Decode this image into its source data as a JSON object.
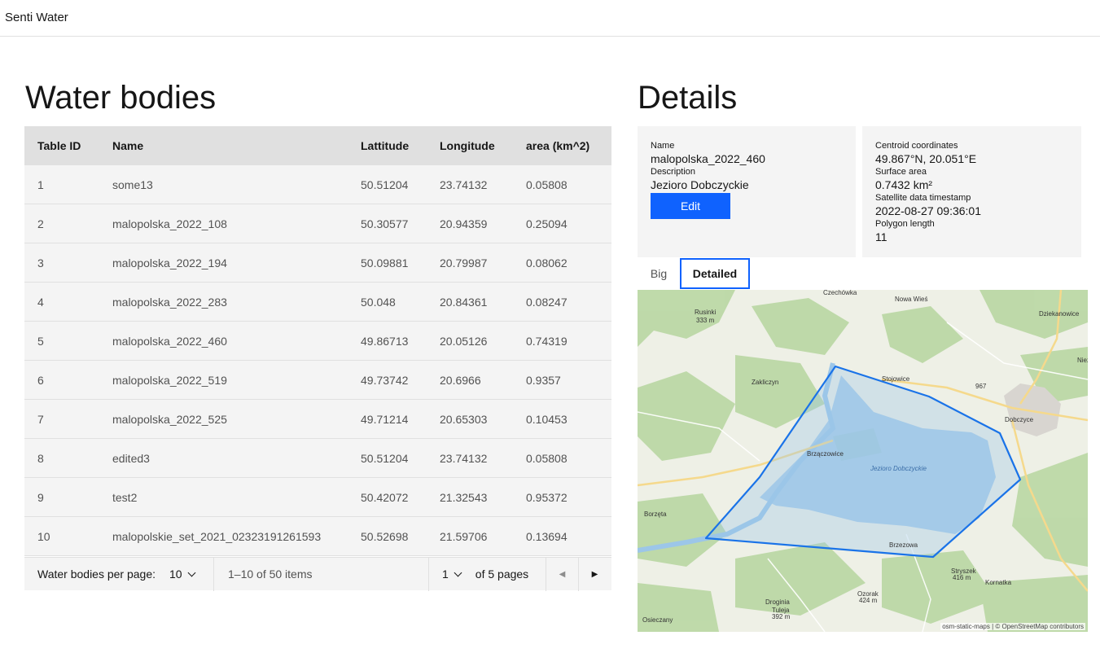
{
  "app": {
    "title": "Senti Water"
  },
  "left": {
    "title": "Water bodies",
    "columns": [
      "Table ID",
      "Name",
      "Lattitude",
      "Longitude",
      "area (km^2)"
    ],
    "rows": [
      [
        "1",
        "some13",
        "50.51204",
        "23.74132",
        "0.05808"
      ],
      [
        "2",
        "malopolska_2022_108",
        "50.30577",
        "20.94359",
        "0.25094"
      ],
      [
        "3",
        "malopolska_2022_194",
        "50.09881",
        "20.79987",
        "0.08062"
      ],
      [
        "4",
        "malopolska_2022_283",
        "50.048",
        "20.84361",
        "0.08247"
      ],
      [
        "5",
        "malopolska_2022_460",
        "49.86713",
        "20.05126",
        "0.74319"
      ],
      [
        "6",
        "malopolska_2022_519",
        "49.73742",
        "20.6966",
        "0.9357"
      ],
      [
        "7",
        "malopolska_2022_525",
        "49.71214",
        "20.65303",
        "0.10453"
      ],
      [
        "8",
        "edited3",
        "50.51204",
        "23.74132",
        "0.05808"
      ],
      [
        "9",
        "test2",
        "50.42072",
        "21.32543",
        "0.95372"
      ],
      [
        "10",
        "malopolskie_set_2021_02323191261593",
        "50.52698",
        "21.59706",
        "0.13694"
      ]
    ],
    "pagination": {
      "per_page_label": "Water bodies per page:",
      "per_page_value": "10",
      "items_range": "1–10 of 50 items",
      "page_value": "1",
      "of_pages": "of 5 pages"
    }
  },
  "details": {
    "title": "Details",
    "name_label": "Name",
    "name_value": "malopolska_2022_460",
    "description_label": "Description",
    "description_value": "Jezioro Dobczyckie",
    "edit_label": "Edit",
    "centroid_label": "Centroid coordinates",
    "centroid_value": "49.867°N, 20.051°E",
    "surface_label": "Surface area",
    "surface_value": "0.7432 km²",
    "timestamp_label": "Satellite data timestamp",
    "timestamp_value": "2022-08-27 09:36:01",
    "polygon_label": "Polygon length",
    "polygon_value": "11",
    "tabs": [
      "Big",
      "Detailed"
    ],
    "active_tab": "Detailed"
  },
  "map": {
    "places": [
      "Czechówka",
      "Nowa Wieś",
      "Dziekanowice",
      "Rusinki 333 m",
      "Zakliczyn",
      "Stojowice",
      "Dobczyce",
      "Brzączowice",
      "Jezioro Dobczyckie",
      "Borzęta",
      "Brzezowa",
      "Droginia",
      "Tuleja 392 m",
      "Osieczany",
      "Kornatka",
      "Stryszek 416 m",
      "Ozorak 424 m",
      "Niez",
      "967"
    ],
    "attribution": "osm-static-maps | © OpenStreetMap contributors",
    "colors": {
      "accent": "#0f62fe",
      "polygon_stroke": "#1a73e8",
      "water": "#9cc6e8"
    }
  }
}
